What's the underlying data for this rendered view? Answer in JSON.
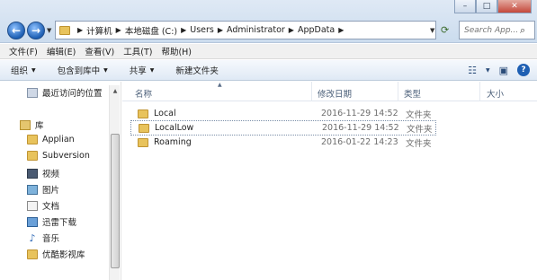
{
  "window": {
    "minimize": "–",
    "maximize": "□",
    "close": "✕"
  },
  "nav": {
    "back": "←",
    "forward": "→"
  },
  "address": {
    "crumbs": [
      "计算机",
      "本地磁盘 (C:)",
      "Users",
      "Administrator",
      "AppData"
    ]
  },
  "search": {
    "placeholder": "Search App..."
  },
  "menu": {
    "items": [
      "文件(F)",
      "编辑(E)",
      "查看(V)",
      "工具(T)",
      "帮助(H)"
    ]
  },
  "commands": {
    "organize": "组织",
    "include_library": "包含到库中",
    "share": "共享",
    "new_folder": "新建文件夹"
  },
  "sidebar": {
    "items": [
      {
        "label": "最近访问的位置",
        "icon": "recent-places-icon"
      },
      {
        "label": "库",
        "icon": "library-icon"
      },
      {
        "label": "Applian",
        "icon": "folder-icon"
      },
      {
        "label": "Subversion",
        "icon": "folder-icon"
      },
      {
        "label": "视频",
        "icon": "video-library-icon"
      },
      {
        "label": "图片",
        "icon": "picture-library-icon"
      },
      {
        "label": "文档",
        "icon": "document-library-icon"
      },
      {
        "label": "迅雷下载",
        "icon": "download-icon"
      },
      {
        "label": "音乐",
        "icon": "music-icon"
      },
      {
        "label": "优酷影视库",
        "icon": "folder-icon"
      }
    ]
  },
  "columns": {
    "name": "名称",
    "modified": "修改日期",
    "type": "类型",
    "size": "大小"
  },
  "files": [
    {
      "name": "Local",
      "modified": "2016-11-29 14:52",
      "type": "文件夹"
    },
    {
      "name": "LocalLow",
      "modified": "2016-11-29 14:52",
      "type": "文件夹"
    },
    {
      "name": "Roaming",
      "modified": "2016-01-22 14:23",
      "type": "文件夹"
    }
  ]
}
